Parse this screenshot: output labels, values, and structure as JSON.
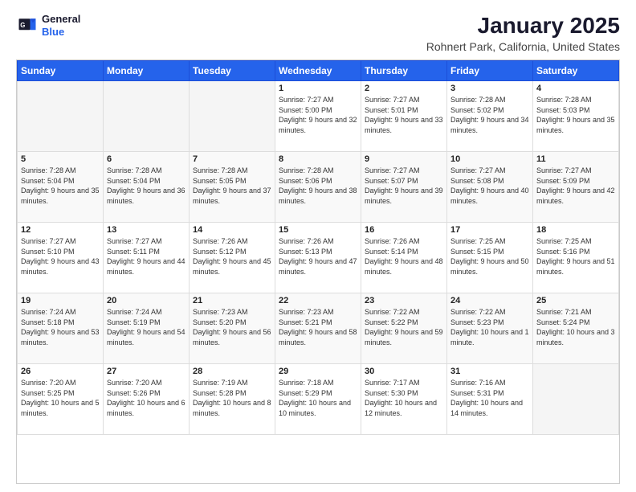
{
  "header": {
    "logo_general": "General",
    "logo_blue": "Blue",
    "title": "January 2025",
    "subtitle": "Rohnert Park, California, United States"
  },
  "weekdays": [
    "Sunday",
    "Monday",
    "Tuesday",
    "Wednesday",
    "Thursday",
    "Friday",
    "Saturday"
  ],
  "weeks": [
    [
      {
        "day": "",
        "info": ""
      },
      {
        "day": "",
        "info": ""
      },
      {
        "day": "",
        "info": ""
      },
      {
        "day": "1",
        "info": "Sunrise: 7:27 AM\nSunset: 5:00 PM\nDaylight: 9 hours\nand 32 minutes."
      },
      {
        "day": "2",
        "info": "Sunrise: 7:27 AM\nSunset: 5:01 PM\nDaylight: 9 hours\nand 33 minutes."
      },
      {
        "day": "3",
        "info": "Sunrise: 7:28 AM\nSunset: 5:02 PM\nDaylight: 9 hours\nand 34 minutes."
      },
      {
        "day": "4",
        "info": "Sunrise: 7:28 AM\nSunset: 5:03 PM\nDaylight: 9 hours\nand 35 minutes."
      }
    ],
    [
      {
        "day": "5",
        "info": "Sunrise: 7:28 AM\nSunset: 5:04 PM\nDaylight: 9 hours\nand 35 minutes."
      },
      {
        "day": "6",
        "info": "Sunrise: 7:28 AM\nSunset: 5:04 PM\nDaylight: 9 hours\nand 36 minutes."
      },
      {
        "day": "7",
        "info": "Sunrise: 7:28 AM\nSunset: 5:05 PM\nDaylight: 9 hours\nand 37 minutes."
      },
      {
        "day": "8",
        "info": "Sunrise: 7:28 AM\nSunset: 5:06 PM\nDaylight: 9 hours\nand 38 minutes."
      },
      {
        "day": "9",
        "info": "Sunrise: 7:27 AM\nSunset: 5:07 PM\nDaylight: 9 hours\nand 39 minutes."
      },
      {
        "day": "10",
        "info": "Sunrise: 7:27 AM\nSunset: 5:08 PM\nDaylight: 9 hours\nand 40 minutes."
      },
      {
        "day": "11",
        "info": "Sunrise: 7:27 AM\nSunset: 5:09 PM\nDaylight: 9 hours\nand 42 minutes."
      }
    ],
    [
      {
        "day": "12",
        "info": "Sunrise: 7:27 AM\nSunset: 5:10 PM\nDaylight: 9 hours\nand 43 minutes."
      },
      {
        "day": "13",
        "info": "Sunrise: 7:27 AM\nSunset: 5:11 PM\nDaylight: 9 hours\nand 44 minutes."
      },
      {
        "day": "14",
        "info": "Sunrise: 7:26 AM\nSunset: 5:12 PM\nDaylight: 9 hours\nand 45 minutes."
      },
      {
        "day": "15",
        "info": "Sunrise: 7:26 AM\nSunset: 5:13 PM\nDaylight: 9 hours\nand 47 minutes."
      },
      {
        "day": "16",
        "info": "Sunrise: 7:26 AM\nSunset: 5:14 PM\nDaylight: 9 hours\nand 48 minutes."
      },
      {
        "day": "17",
        "info": "Sunrise: 7:25 AM\nSunset: 5:15 PM\nDaylight: 9 hours\nand 50 minutes."
      },
      {
        "day": "18",
        "info": "Sunrise: 7:25 AM\nSunset: 5:16 PM\nDaylight: 9 hours\nand 51 minutes."
      }
    ],
    [
      {
        "day": "19",
        "info": "Sunrise: 7:24 AM\nSunset: 5:18 PM\nDaylight: 9 hours\nand 53 minutes."
      },
      {
        "day": "20",
        "info": "Sunrise: 7:24 AM\nSunset: 5:19 PM\nDaylight: 9 hours\nand 54 minutes."
      },
      {
        "day": "21",
        "info": "Sunrise: 7:23 AM\nSunset: 5:20 PM\nDaylight: 9 hours\nand 56 minutes."
      },
      {
        "day": "22",
        "info": "Sunrise: 7:23 AM\nSunset: 5:21 PM\nDaylight: 9 hours\nand 58 minutes."
      },
      {
        "day": "23",
        "info": "Sunrise: 7:22 AM\nSunset: 5:22 PM\nDaylight: 9 hours\nand 59 minutes."
      },
      {
        "day": "24",
        "info": "Sunrise: 7:22 AM\nSunset: 5:23 PM\nDaylight: 10 hours\nand 1 minute."
      },
      {
        "day": "25",
        "info": "Sunrise: 7:21 AM\nSunset: 5:24 PM\nDaylight: 10 hours\nand 3 minutes."
      }
    ],
    [
      {
        "day": "26",
        "info": "Sunrise: 7:20 AM\nSunset: 5:25 PM\nDaylight: 10 hours\nand 5 minutes."
      },
      {
        "day": "27",
        "info": "Sunrise: 7:20 AM\nSunset: 5:26 PM\nDaylight: 10 hours\nand 6 minutes."
      },
      {
        "day": "28",
        "info": "Sunrise: 7:19 AM\nSunset: 5:28 PM\nDaylight: 10 hours\nand 8 minutes."
      },
      {
        "day": "29",
        "info": "Sunrise: 7:18 AM\nSunset: 5:29 PM\nDaylight: 10 hours\nand 10 minutes."
      },
      {
        "day": "30",
        "info": "Sunrise: 7:17 AM\nSunset: 5:30 PM\nDaylight: 10 hours\nand 12 minutes."
      },
      {
        "day": "31",
        "info": "Sunrise: 7:16 AM\nSunset: 5:31 PM\nDaylight: 10 hours\nand 14 minutes."
      },
      {
        "day": "",
        "info": ""
      }
    ]
  ]
}
